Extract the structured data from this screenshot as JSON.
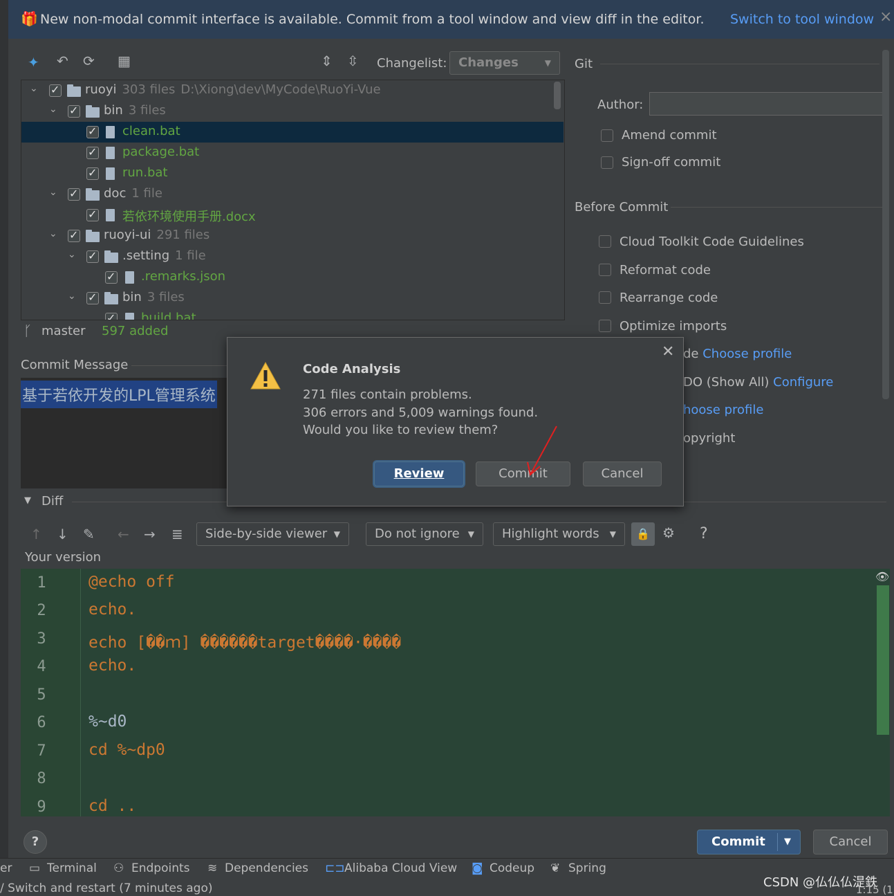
{
  "banner": {
    "text": "New non-modal commit interface is available. Commit from a tool window and view diff in the editor.",
    "link": "Switch to tool window",
    "close": "×"
  },
  "toolbar": {
    "changelist_label": "Changelist:",
    "changelist_value": "Changes"
  },
  "tree": [
    {
      "name": "ruoyi",
      "count": "303 files",
      "path": "D:\\Xiong\\dev\\MyCode\\RuoYi-Vue",
      "type": "module"
    },
    {
      "name": "bin",
      "count": "3 files",
      "type": "folder"
    },
    {
      "name": "clean.bat",
      "type": "file",
      "selected": true
    },
    {
      "name": "package.bat",
      "type": "file"
    },
    {
      "name": "run.bat",
      "type": "file"
    },
    {
      "name": "doc",
      "count": "1 file",
      "type": "folder"
    },
    {
      "name": "若依环境使用手册.docx",
      "type": "file"
    },
    {
      "name": "ruoyi-ui",
      "count": "291 files",
      "type": "folder"
    },
    {
      "name": ".setting",
      "count": "1 file",
      "type": "folder"
    },
    {
      "name": ".remarks.json",
      "type": "file"
    },
    {
      "name": "bin",
      "count": "3 files",
      "type": "folder"
    },
    {
      "name": "build.bat",
      "type": "file"
    }
  ],
  "branch": {
    "name": "master",
    "added": "597 added"
  },
  "commit_message": {
    "label": "Commit Message",
    "text": "基于若依开发的LPL管理系统"
  },
  "git": {
    "section": "Git",
    "author_label": "Author:",
    "author_value": "",
    "amend": "Amend commit",
    "signoff": "Sign-off commit"
  },
  "before_commit": {
    "section": "Before Commit",
    "items": [
      "Cloud Toolkit Code Guidelines",
      "Reformat code",
      "Rearrange code",
      "Optimize imports"
    ],
    "partial": [
      {
        "text": "de",
        "link": "Choose profile"
      },
      {
        "text": "DO (Show All)",
        "link": "Configure"
      },
      {
        "text": "",
        "link": "hoose profile"
      },
      {
        "text": "opyright",
        "link": ""
      }
    ]
  },
  "dialog": {
    "title": "Code Analysis",
    "line1": "271 files contain problems.",
    "line2": "306 errors and 5,009 warnings found.",
    "line3": "Would you like to review them?",
    "review": "Review",
    "commit": "Commit",
    "cancel": "Cancel"
  },
  "diff": {
    "label": "Diff",
    "viewer": "Side-by-side viewer",
    "ignore": "Do not ignore",
    "highlight": "Highlight words",
    "help": "?",
    "version_label": "Your version",
    "lines": [
      {
        "n": "1",
        "code": "@echo off",
        "kw": true
      },
      {
        "n": "2",
        "code": "echo.",
        "kw": true
      },
      {
        "n": "3",
        "code": "echo [��ｍ] ������target����·����",
        "kw": true
      },
      {
        "n": "4",
        "code": "echo.",
        "kw": true
      },
      {
        "n": "5",
        "code": "",
        "kw": false
      },
      {
        "n": "6",
        "code": "%~d0",
        "kw": false
      },
      {
        "n": "7",
        "code": "cd %~dp0",
        "kw": true
      },
      {
        "n": "8",
        "code": "",
        "kw": false
      },
      {
        "n": "9",
        "code": "cd ..",
        "kw": true
      }
    ]
  },
  "footer": {
    "help": "?",
    "commit": "Commit",
    "cancel": "Cancel"
  },
  "statusbar": {
    "items": [
      "er",
      "Terminal",
      "Endpoints",
      "Dependencies",
      "Alibaba Cloud View",
      "Codeup",
      "Spring"
    ],
    "bottom_text": "/ Switch and restart (7 minutes ago)",
    "watermark": "CSDN @仏仏仏湜鉄",
    "position": "1:15 (1"
  }
}
